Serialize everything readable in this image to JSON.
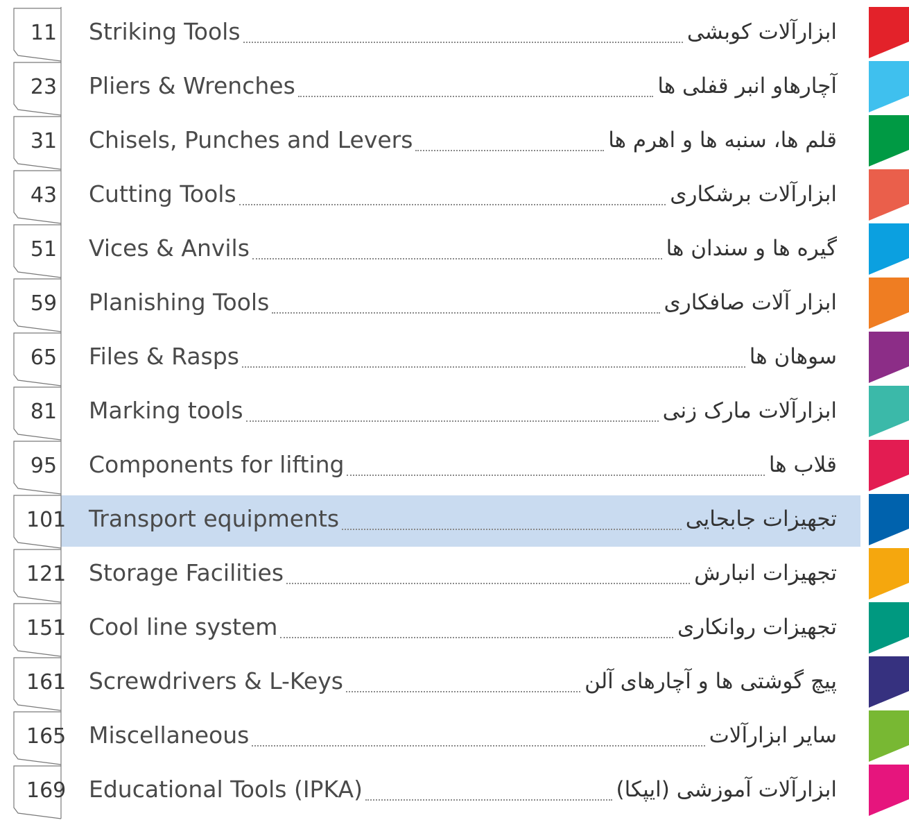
{
  "toc": {
    "entries": [
      {
        "page": "11",
        "en": "Striking Tools",
        "fa": "ابزارآلات کوبشی",
        "color": "#e3222a"
      },
      {
        "page": "23",
        "en": "Pliers & Wrenches",
        "fa": "آچارهاو انبر قفلی ها",
        "color": "#3fc0ee"
      },
      {
        "page": "31",
        "en": "Chisels, Punches and Levers",
        "fa": "قلم ها، سنبه ها و اهرم ها",
        "color": "#009a44"
      },
      {
        "page": "43",
        "en": "Cutting Tools",
        "fa": "ابزارآلات برشکاری",
        "color": "#ea5f4b"
      },
      {
        "page": "51",
        "en": "Vices & Anvils",
        "fa": "گیره ها و سندان ها",
        "color": "#0ba0e0"
      },
      {
        "page": "59",
        "en": "Planishing Tools",
        "fa": "ابزار آلات صافکاری",
        "color": "#ef7d22"
      },
      {
        "page": "65",
        "en": "Files & Rasps",
        "fa": "سوهان ها",
        "color": "#8c2d87"
      },
      {
        "page": "81",
        "en": "Marking tools",
        "fa": "ابزارآلات مارک زنی",
        "color": "#3bb9a9"
      },
      {
        "page": "95",
        "en": "Components for lifting",
        "fa": "قلاب ها",
        "color": "#e31c52"
      },
      {
        "page": "101",
        "en": "Transport equipments",
        "fa": "تجهیزات جابجایی",
        "color": "#0062ad"
      },
      {
        "page": "121",
        "en": "Storage Facilities",
        "fa": "تجهیزات انبارش",
        "color": "#f5a70e"
      },
      {
        "page": "151",
        "en": "Cool line system",
        "fa": "تجهیزات روانکاری",
        "color": "#009980"
      },
      {
        "page": "161",
        "en": "Screwdrivers & L-Keys",
        "fa": "پیچ گوشتی ها و آچارهای آلن",
        "color": "#36317f"
      },
      {
        "page": "165",
        "en": "Miscellaneous",
        "fa": "سایر ابزارآلات",
        "color": "#78b833"
      },
      {
        "page": "169",
        "en": "Educational Tools (IPKA)",
        "fa": "ابزارآلات آموزشی (ایپکا)",
        "color": "#e6157d"
      }
    ],
    "highlighted_page": "101"
  }
}
